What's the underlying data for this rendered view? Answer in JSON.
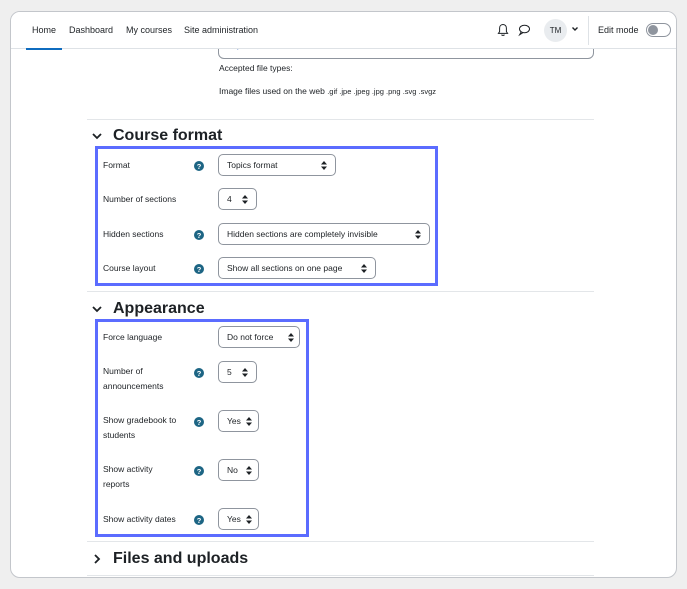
{
  "navbar": {
    "items": [
      {
        "label": "Home",
        "active": true
      },
      {
        "label": "Dashboard",
        "active": false
      },
      {
        "label": "My courses",
        "active": false
      },
      {
        "label": "Site administration",
        "active": false
      }
    ],
    "icons": [
      "bell-icon",
      "chat-icon"
    ],
    "avatar_initials": "TM",
    "edit_mode_label": "Edit mode",
    "edit_mode_on": false
  },
  "top_section": {
    "payment_field_partial": "Payment name",
    "accepted_label": "Accepted file types:",
    "file_types_desc": "Image files used on the web",
    "file_types_ext": ".gif .jpe .jpeg .jpg .png .svg .svgz"
  },
  "course_format": {
    "title": "Course format",
    "expanded": true,
    "fields": [
      {
        "label": "Format",
        "has_help": true,
        "value": "Topics format"
      },
      {
        "label": "Number of sections",
        "has_help": false,
        "value": "4"
      },
      {
        "label": "Hidden sections",
        "has_help": true,
        "value": "Hidden sections are completely invisible"
      },
      {
        "label": "Course layout",
        "has_help": true,
        "value": "Show all sections on one page"
      }
    ]
  },
  "appearance": {
    "title": "Appearance",
    "expanded": true,
    "fields": [
      {
        "label": "Force language",
        "has_help": false,
        "value": "Do not force"
      },
      {
        "label": "Number of announcements",
        "label_l1": "Number of",
        "label_l2": "announcements",
        "has_help": true,
        "value": "5"
      },
      {
        "label": "Show gradebook to students",
        "label_l1": "Show gradebook to",
        "label_l2": "students",
        "has_help": true,
        "value": "Yes"
      },
      {
        "label": "Show activity reports",
        "label_l1": "Show activity",
        "label_l2": "reports",
        "has_help": true,
        "value": "No"
      },
      {
        "label": "Show activity dates",
        "has_help": true,
        "value": "Yes"
      }
    ]
  },
  "files_and_uploads": {
    "title": "Files and uploads",
    "expanded": false
  },
  "colors": {
    "accent": "#0f6cbf",
    "highlight": "#5b6cff",
    "help_icon": "#1d6584"
  }
}
